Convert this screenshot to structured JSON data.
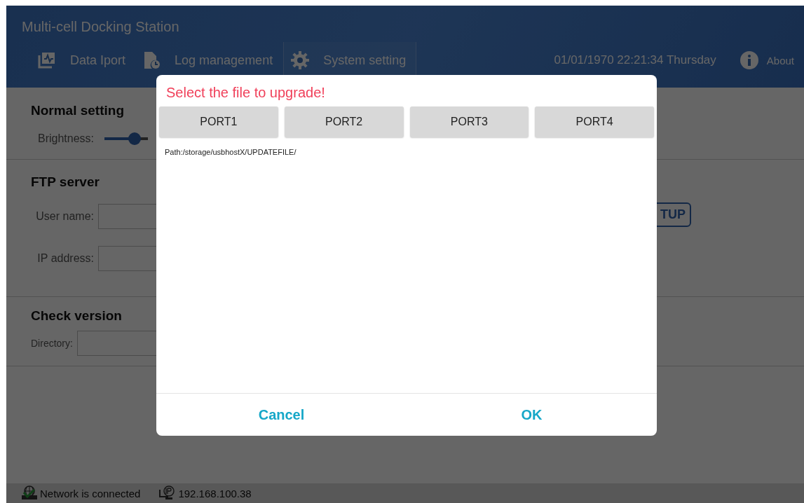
{
  "window": {
    "title": "Multi-cell Docking Station"
  },
  "tabs": [
    {
      "label": "Data Iport",
      "kind": "chart",
      "selected": false
    },
    {
      "label": "Log management",
      "kind": "log",
      "selected": false
    },
    {
      "label": "System setting",
      "kind": "gear",
      "selected": true
    }
  ],
  "datetime": "01/01/1970 22:21:34 Thursday",
  "about": {
    "label": "About"
  },
  "sections": [
    {
      "title": "Normal setting",
      "rows": [
        {
          "kind": "slider",
          "label": "Brightness:",
          "level": 0.7
        }
      ]
    },
    {
      "title": "FTP server",
      "rows": [
        {
          "kind": "field",
          "label": "User name:"
        },
        {
          "kind": "field",
          "label": "IP address:"
        }
      ],
      "button": "TUP"
    },
    {
      "title": "Check version",
      "rows": [
        {
          "kind": "field",
          "label": "Directory:"
        }
      ]
    }
  ],
  "status_bar": {
    "network": "Network is connected",
    "ip": "192.168.100.38"
  },
  "dialog": {
    "title": "Select the file to upgrade!",
    "ports": [
      {
        "label": "PORT1"
      },
      {
        "label": "PORT2"
      },
      {
        "label": "PORT3"
      },
      {
        "label": "PORT4"
      }
    ],
    "path": "Path:/storage/usbhostX/UPDATEFILE/",
    "buttons": [
      "Cancel",
      "OK"
    ]
  }
}
